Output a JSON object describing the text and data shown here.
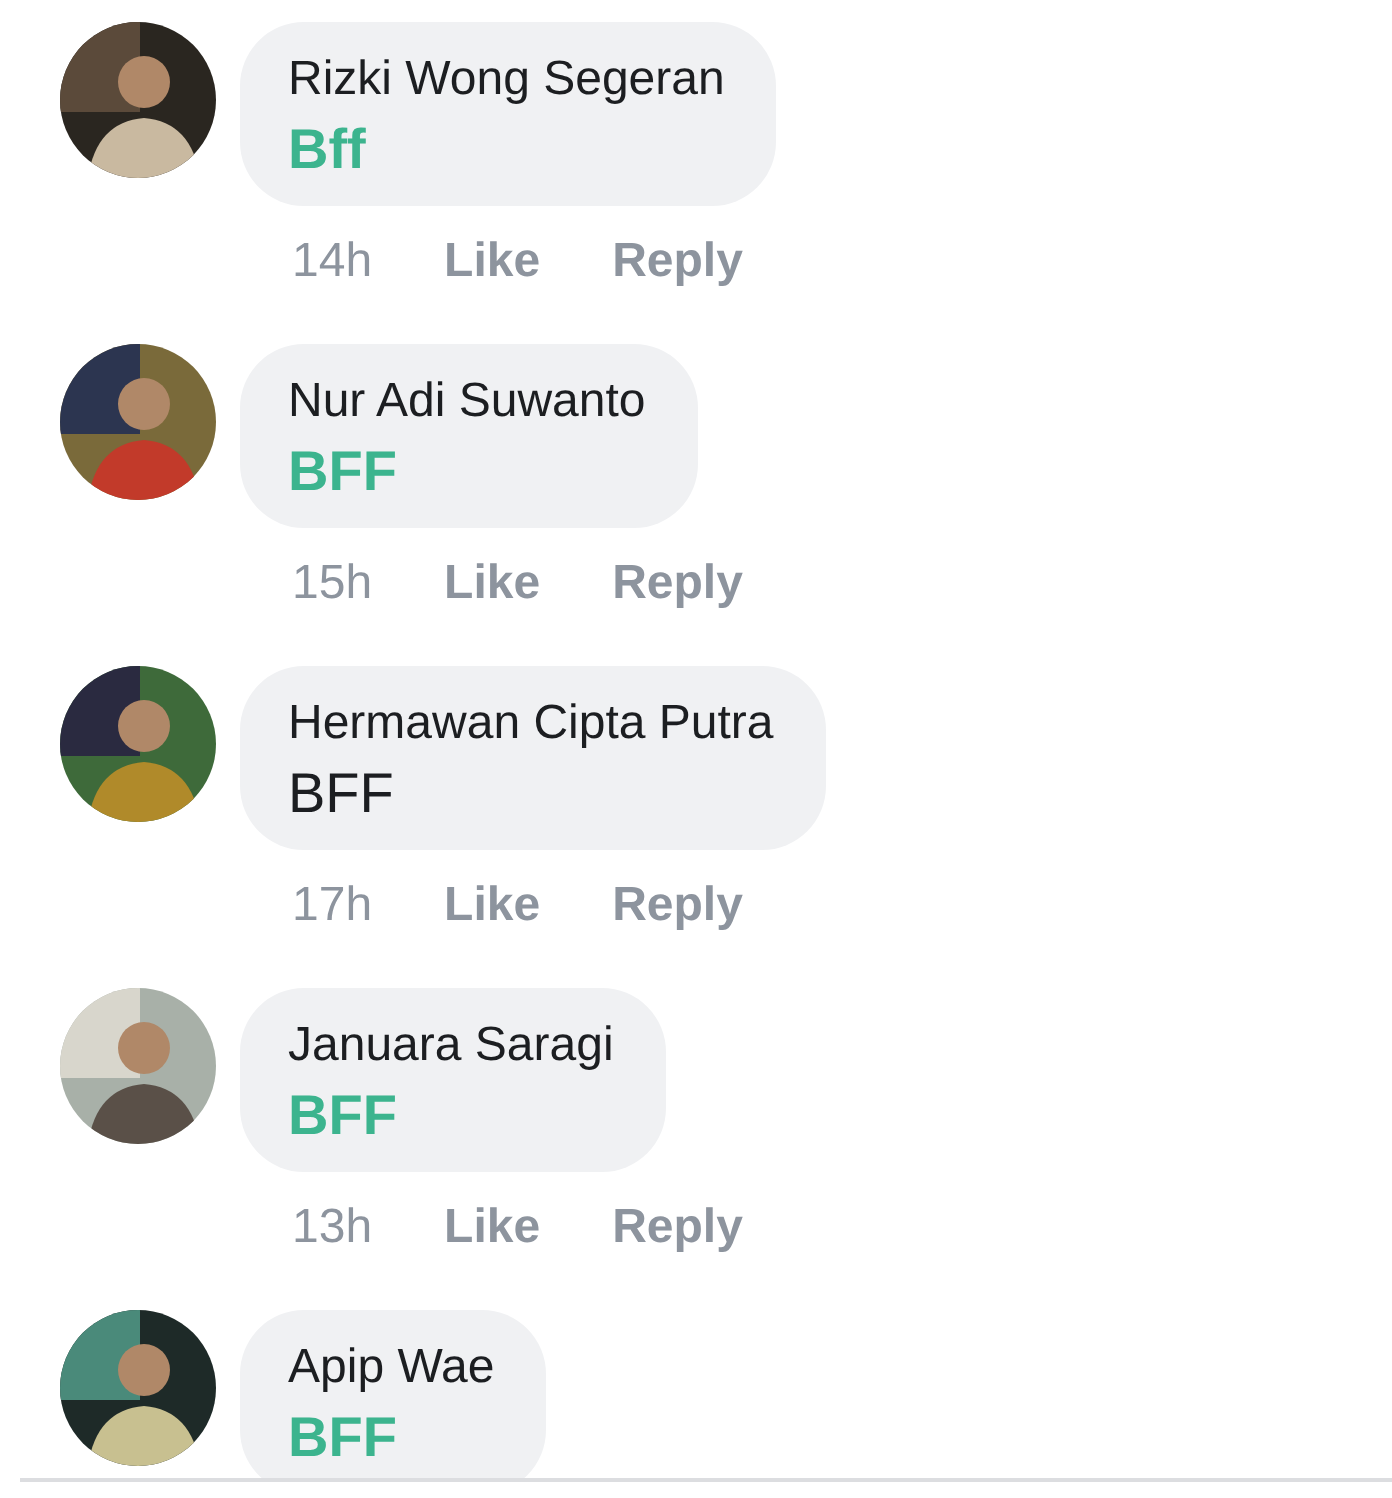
{
  "comments": [
    {
      "name": "Rizki Wong Segeran",
      "text": "Bff",
      "color": "#3cb48e",
      "time": "14h",
      "like": "Like",
      "reply": "Reply"
    },
    {
      "name": "Nur Adi Suwanto",
      "text": "BFF",
      "color": "#3cb48e",
      "time": "15h",
      "like": "Like",
      "reply": "Reply"
    },
    {
      "name": "Hermawan Cipta Putra",
      "text": "BFF",
      "color": "#1c1e21",
      "time": "17h",
      "like": "Like",
      "reply": "Reply"
    },
    {
      "name": "Januara Saragi",
      "text": "BFF",
      "color": "#3cb48e",
      "time": "13h",
      "like": "Like",
      "reply": "Reply"
    },
    {
      "name": "Apip Wae",
      "text": "BFF",
      "color": "#3cb48e"
    }
  ]
}
